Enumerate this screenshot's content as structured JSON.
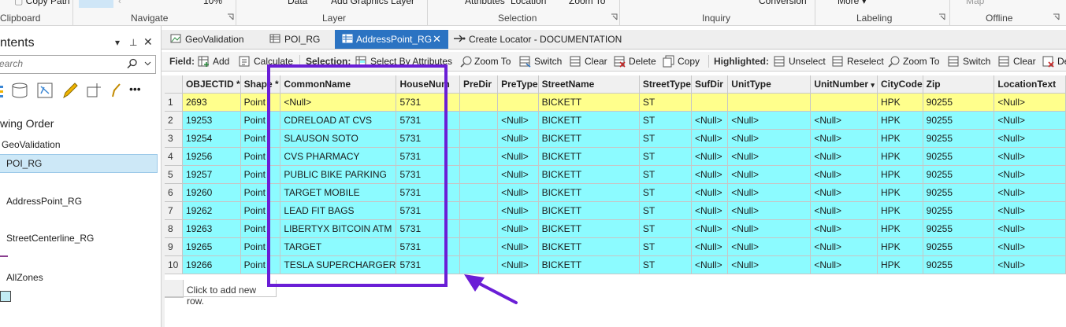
{
  "ribbon": {
    "items": [
      "Copy Path",
      "10%",
      "Data",
      "Add Graphics Layer",
      "Attributes",
      "Location",
      "Zoom To",
      "Conversion",
      "More",
      "Map"
    ],
    "groups": [
      "Clipboard",
      "Navigate",
      "Layer",
      "Selection",
      "Inquiry",
      "Labeling",
      "Offline"
    ]
  },
  "contents": {
    "title": "ntents",
    "search_placeholder": "earch",
    "drawing_order": "wing Order",
    "layers": [
      "GeoValidation",
      "POI_RG",
      "AddressPoint_RG",
      "StreetCenterline_RG",
      "AllZones"
    ],
    "pin": "ꟷ",
    "selected_layer": "POI_RG"
  },
  "tabs": [
    {
      "label": "GeoValidation",
      "icon": "table-icon"
    },
    {
      "label": "POI_RG",
      "icon": "table-icon"
    },
    {
      "label": "AddressPoint_RG",
      "icon": "table-icon",
      "active": true
    },
    {
      "label": "Create Locator - DOCUMENTATION",
      "icon": "arrow-icon"
    }
  ],
  "toolbar": {
    "field_label": "Field:",
    "add": "Add",
    "calculate": "Calculate",
    "selection_label": "Selection:",
    "select_by_attributes": "Select By Attributes",
    "zoom_to": "Zoom To",
    "switch": "Switch",
    "clear": "Clear",
    "delete": "Delete",
    "copy": "Copy",
    "highlighted_label": "Highlighted:",
    "unselect": "Unselect",
    "reselect": "Reselect",
    "zoom_to_2": "Zoom To",
    "switch_2": "Switch",
    "clear_2": "Clear",
    "delete_2": "De"
  },
  "grid": {
    "columns": [
      "OBJECTID *",
      "Shape *",
      "CommonName",
      "HouseNum",
      "PreDir",
      "PreType",
      "StreetName",
      "StreetType",
      "SufDir",
      "UnitType",
      "UnitNumber",
      "CityCode",
      "Zip",
      "LocationText"
    ],
    "rows": [
      [
        "1",
        "2693",
        "Point",
        "<Null>",
        "5731",
        "",
        "",
        "BICKETT",
        "ST",
        "",
        "",
        "",
        "HPK",
        "90255",
        "<Null>"
      ],
      [
        "2",
        "19253",
        "Point",
        "CDRELOAD AT CVS",
        "5731",
        "",
        "<Null>",
        "BICKETT",
        "ST",
        "<Null>",
        "<Null>",
        "<Null>",
        "HPK",
        "90255",
        "<Null>"
      ],
      [
        "3",
        "19254",
        "Point",
        "SLAUSON SOTO",
        "5731",
        "",
        "<Null>",
        "BICKETT",
        "ST",
        "<Null>",
        "<Null>",
        "<Null>",
        "HPK",
        "90255",
        "<Null>"
      ],
      [
        "4",
        "19256",
        "Point",
        "CVS PHARMACY",
        "5731",
        "",
        "<Null>",
        "BICKETT",
        "ST",
        "<Null>",
        "<Null>",
        "<Null>",
        "HPK",
        "90255",
        "<Null>"
      ],
      [
        "5",
        "19257",
        "Point",
        "PUBLIC BIKE PARKING",
        "5731",
        "",
        "<Null>",
        "BICKETT",
        "ST",
        "<Null>",
        "<Null>",
        "<Null>",
        "HPK",
        "90255",
        "<Null>"
      ],
      [
        "6",
        "19260",
        "Point",
        "TARGET MOBILE",
        "5731",
        "",
        "<Null>",
        "BICKETT",
        "ST",
        "<Null>",
        "<Null>",
        "<Null>",
        "HPK",
        "90255",
        "<Null>"
      ],
      [
        "7",
        "19262",
        "Point",
        "LEAD FIT BAGS",
        "5731",
        "",
        "<Null>",
        "BICKETT",
        "ST",
        "<Null>",
        "<Null>",
        "<Null>",
        "HPK",
        "90255",
        "<Null>"
      ],
      [
        "8",
        "19263",
        "Point",
        "LIBERTYX BITCOIN ATM",
        "5731",
        "",
        "<Null>",
        "BICKETT",
        "ST",
        "<Null>",
        "<Null>",
        "<Null>",
        "HPK",
        "90255",
        "<Null>"
      ],
      [
        "9",
        "19265",
        "Point",
        "TARGET",
        "5731",
        "",
        "<Null>",
        "BICKETT",
        "ST",
        "<Null>",
        "<Null>",
        "<Null>",
        "HPK",
        "90255",
        "<Null>"
      ],
      [
        "10",
        "19266",
        "Point",
        "TESLA SUPERCHARGER",
        "5731",
        "",
        "<Null>",
        "BICKETT",
        "ST",
        "<Null>",
        "<Null>",
        "<Null>",
        "HPK",
        "90255",
        "<Null>"
      ]
    ],
    "add_row_text": "Click to add new row."
  },
  "colors": {
    "active_tab": "#2b73c2",
    "highlight_yellow": "#ffff8c",
    "selection_cyan": "#8cfbff",
    "annotation_purple": "#6a1ed6"
  }
}
